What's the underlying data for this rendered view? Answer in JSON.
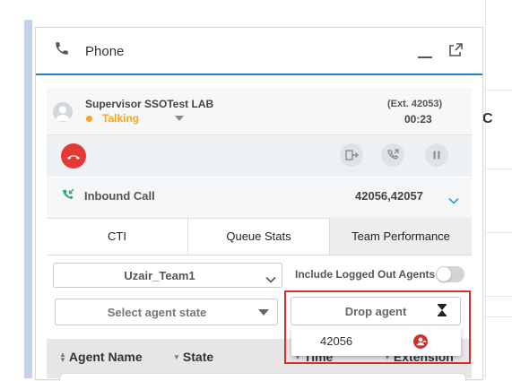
{
  "phone": {
    "title": "Phone"
  },
  "agent": {
    "name": "Supervisor SSOTest LAB",
    "status": "Talking",
    "extension": "(Ext. 42053)",
    "timer": "00:23"
  },
  "call": {
    "type_label": "Inbound Call",
    "number": "42056,42057"
  },
  "tabs": [
    {
      "label": "CTI",
      "active": false
    },
    {
      "label": "Queue Stats",
      "active": false
    },
    {
      "label": "Team Performance",
      "active": true
    }
  ],
  "filters": {
    "team": "Uzair_Team1",
    "include_logged_out_label": "Include Logged Out Agents",
    "include_logged_out": false,
    "agent_state_placeholder": "Select agent state",
    "drop_agent_label": "Drop agent",
    "drop_agent_options": [
      "42056"
    ]
  },
  "table": {
    "columns": [
      "Agent Name",
      "State",
      "Time",
      "Extension"
    ]
  },
  "side": {
    "partial_char": "C"
  },
  "colors": {
    "accent": "#2a7fbf",
    "talking": "#f5a623",
    "hangup": "#e53935",
    "highlight_box": "#d0312d"
  }
}
